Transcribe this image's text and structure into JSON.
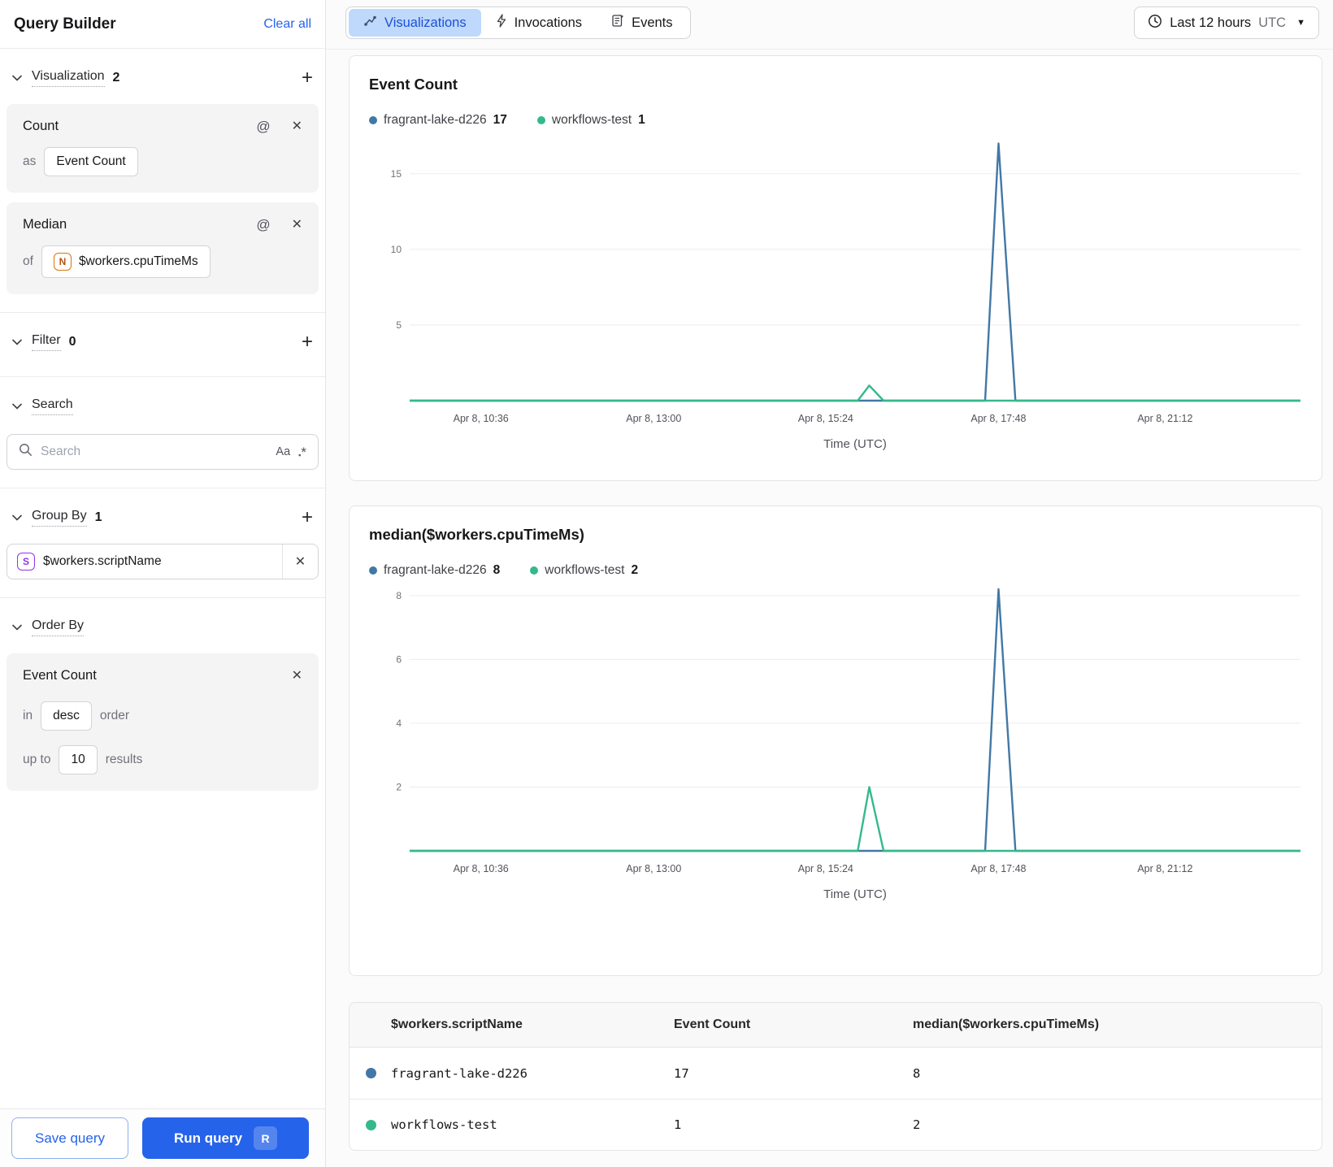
{
  "sidebar": {
    "title": "Query Builder",
    "clear_all": "Clear all",
    "visualization": {
      "label": "Visualization",
      "count": "2",
      "cards": [
        {
          "name": "Count",
          "prefix": "as",
          "value": "Event Count"
        },
        {
          "name": "Median",
          "prefix": "of",
          "field_icon": "N",
          "value": "$workers.cpuTimeMs"
        }
      ]
    },
    "filter": {
      "label": "Filter",
      "count": "0"
    },
    "search": {
      "label": "Search",
      "placeholder": "Search",
      "case_icon": "Aa",
      "regex_square": "▪",
      "regex_star": "*"
    },
    "group_by": {
      "label": "Group By",
      "count": "1",
      "field_icon": "S",
      "value": "$workers.scriptName"
    },
    "order_by": {
      "label": "Order By",
      "field": "Event Count",
      "in_label": "in",
      "direction": "desc",
      "order_label": "order",
      "upto_label": "up to",
      "limit": "10",
      "results_label": "results"
    },
    "save_button": "Save query",
    "run_button": "Run query",
    "run_shortcut": "R"
  },
  "topbar": {
    "tabs": [
      {
        "label": "Visualizations"
      },
      {
        "label": "Invocations"
      },
      {
        "label": "Events"
      }
    ],
    "active_tab": "Visualizations",
    "time_range": {
      "label": "Last 12 hours",
      "zone": "UTC"
    }
  },
  "chart_data": [
    {
      "type": "line",
      "title": "Event Count",
      "xlabel": "Time (UTC)",
      "ylim": [
        0,
        17.3
      ],
      "yticks": [
        5,
        10,
        15
      ],
      "x_ticks": [
        {
          "label": "Apr 8, 10:36",
          "pos": 0.08
        },
        {
          "label": "Apr 8, 13:00",
          "pos": 0.274
        },
        {
          "label": "Apr 8, 15:24",
          "pos": 0.467
        },
        {
          "label": "Apr 8, 17:48",
          "pos": 0.661
        },
        {
          "label": "Apr 8, 21:12",
          "pos": 0.848
        }
      ],
      "legend": [
        {
          "name": "fragrant-lake-d226",
          "value": "17",
          "color": "#4278a6"
        },
        {
          "name": "workflows-test",
          "value": "1",
          "color": "#35b98a"
        }
      ],
      "series": [
        {
          "name": "fragrant-lake-d226",
          "color": "#4278a6",
          "points": [
            [
              0,
              0
            ],
            [
              0.646,
              0
            ],
            [
              0.661,
              17
            ],
            [
              0.68,
              0
            ],
            [
              1,
              0
            ]
          ]
        },
        {
          "name": "workflows-test",
          "color": "#35b98a",
          "points": [
            [
              0,
              0
            ],
            [
              0.503,
              0
            ],
            [
              0.516,
              1
            ],
            [
              0.532,
              0
            ],
            [
              1,
              0
            ]
          ]
        }
      ]
    },
    {
      "type": "line",
      "title": "median($workers.cpuTimeMs)",
      "xlabel": "Time (UTC)",
      "ylim": [
        0,
        8.2
      ],
      "yticks": [
        2,
        4,
        6,
        8
      ],
      "x_ticks": [
        {
          "label": "Apr 8, 10:36",
          "pos": 0.08
        },
        {
          "label": "Apr 8, 13:00",
          "pos": 0.274
        },
        {
          "label": "Apr 8, 15:24",
          "pos": 0.467
        },
        {
          "label": "Apr 8, 17:48",
          "pos": 0.661
        },
        {
          "label": "Apr 8, 21:12",
          "pos": 0.848
        }
      ],
      "legend": [
        {
          "name": "fragrant-lake-d226",
          "value": "8",
          "color": "#4278a6"
        },
        {
          "name": "workflows-test",
          "value": "2",
          "color": "#35b98a"
        }
      ],
      "series": [
        {
          "name": "fragrant-lake-d226",
          "color": "#4278a6",
          "points": [
            [
              0,
              0
            ],
            [
              0.646,
              0
            ],
            [
              0.661,
              8.2
            ],
            [
              0.68,
              0
            ],
            [
              1,
              0
            ]
          ]
        },
        {
          "name": "workflows-test",
          "color": "#35b98a",
          "points": [
            [
              0,
              0
            ],
            [
              0.503,
              0
            ],
            [
              0.516,
              2
            ],
            [
              0.532,
              0
            ],
            [
              1,
              0
            ]
          ]
        }
      ]
    }
  ],
  "table": {
    "headers": [
      "$workers.scriptName",
      "Event Count",
      "median($workers.cpuTimeMs)"
    ],
    "rows": [
      {
        "color": "#4278a6",
        "name": "fragrant-lake-d226",
        "event_count": "17",
        "median": "8"
      },
      {
        "color": "#35b98a",
        "name": "workflows-test",
        "event_count": "1",
        "median": "2"
      }
    ]
  }
}
